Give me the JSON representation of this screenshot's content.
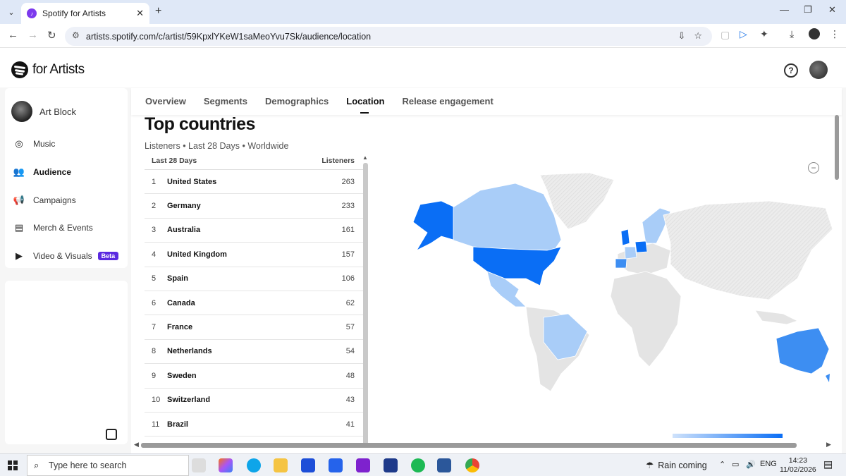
{
  "browser": {
    "tab_title": "Spotify for Artists",
    "url": "artists.spotify.com/c/artist/59KpxlYKeW1saMeoYvu7Sk/audience/location"
  },
  "app": {
    "logo_text": "for Artists",
    "help_label": "?"
  },
  "sidebar": {
    "artist_name": "Art Block",
    "items": [
      {
        "label": "Music",
        "icon": "disc-icon"
      },
      {
        "label": "Audience",
        "icon": "people-icon"
      },
      {
        "label": "Campaigns",
        "icon": "megaphone-icon"
      },
      {
        "label": "Merch & Events",
        "icon": "ticket-icon"
      },
      {
        "label": "Video & Visuals",
        "icon": "video-icon"
      }
    ],
    "beta_badge": "Beta"
  },
  "tabs": [
    "Overview",
    "Segments",
    "Demographics",
    "Location",
    "Release engagement"
  ],
  "main": {
    "heading": "Top countries",
    "subtitle": "Listeners • Last 28 Days • Worldwide",
    "table": {
      "col_period": "Last 28 Days",
      "col_value": "Listeners",
      "rows": [
        {
          "rank": "1",
          "country": "United States",
          "listeners": "263"
        },
        {
          "rank": "2",
          "country": "Germany",
          "listeners": "233"
        },
        {
          "rank": "3",
          "country": "Australia",
          "listeners": "161"
        },
        {
          "rank": "4",
          "country": "United Kingdom",
          "listeners": "157"
        },
        {
          "rank": "5",
          "country": "Spain",
          "listeners": "106"
        },
        {
          "rank": "6",
          "country": "Canada",
          "listeners": "62"
        },
        {
          "rank": "7",
          "country": "France",
          "listeners": "57"
        },
        {
          "rank": "8",
          "country": "Netherlands",
          "listeners": "54"
        },
        {
          "rank": "9",
          "country": "Sweden",
          "listeners": "48"
        },
        {
          "rank": "10",
          "country": "Switzerland",
          "listeners": "43"
        },
        {
          "rank": "11",
          "country": "Brazil",
          "listeners": "41"
        }
      ]
    },
    "zoom_out_label": "−"
  },
  "colors": {
    "map_high": "#0a6ef5",
    "map_mid": "#3d8ef2",
    "map_low": "#a9cdf8",
    "map_none": "#e4e4e4",
    "beta": "#5b2ae0"
  },
  "taskbar": {
    "search_placeholder": "Type here to search",
    "weather": "Rain coming",
    "language": "ENG",
    "time": "14:23",
    "date": "11/02/2026"
  }
}
